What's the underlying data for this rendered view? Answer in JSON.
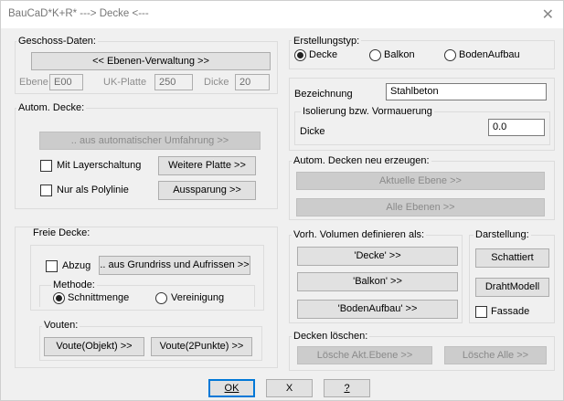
{
  "window": {
    "title": "BauCaD*K+R* ---> Decke <---",
    "close_glyph": "✕"
  },
  "geschoss": {
    "label": "Geschoss-Daten:",
    "ebenen_button": "<< Ebenen-Verwaltung >>",
    "ebene_label": "Ebene",
    "ebene_value": "E00",
    "uk_label": "UK-Platte",
    "uk_value": "250",
    "dicke_label": "Dicke",
    "dicke_value": "20"
  },
  "autom": {
    "label": "Autom. Decke:",
    "umfahrung_button": ".. aus automatischer Umfahrung >>",
    "layerschaltung_label": "Mit Layerschaltung",
    "weitere_button": "Weitere Platte >>",
    "polylinie_label": "Nur als Polylinie",
    "aussparung_button": "Aussparung >>"
  },
  "freie": {
    "label": "Freie Decke:",
    "abzug_label": "Abzug",
    "grundriss_button": ".. aus Grundriss und Aufrissen >>",
    "methode_label": "Methode:",
    "schnittmenge_label": "Schnittmenge",
    "vereinigung_label": "Vereinigung",
    "vouten_label": "Vouten:",
    "voute_objekt_button": "Voute(Objekt) >>",
    "voute_punkte_button": "Voute(2Punkte) >>"
  },
  "erstellungstyp": {
    "label": "Erstellungstyp:",
    "options": [
      "Decke",
      "Balkon",
      "BodenAufbau"
    ],
    "selected": "Decke"
  },
  "bezeichnung": {
    "label": "Bezeichnung",
    "value": "Stahlbeton",
    "isolierung_label": "Isolierung bzw. Vormauerung",
    "dicke_label": "Dicke",
    "dicke_value": "0.0"
  },
  "neu": {
    "label": "Autom. Decken neu erzeugen:",
    "aktuelle_button": "Aktuelle Ebene >>",
    "alle_button": "Alle Ebenen >>"
  },
  "volumen": {
    "label": "Vorh. Volumen definieren als:",
    "decke_button": "'Decke' >>",
    "balkon_button": "'Balkon' >>",
    "boden_button": "'BodenAufbau' >>"
  },
  "darstellung": {
    "label": "Darstellung:",
    "schattiert_button": "Schattiert",
    "draht_button": "DrahtModell",
    "fassade_label": "Fassade"
  },
  "loeschen": {
    "label": "Decken löschen:",
    "akt_button": "Lösche Akt.Ebene >>",
    "alle_button": "Lösche Alle >>"
  },
  "footer": {
    "ok": "OK",
    "x": "X",
    "help": "?"
  }
}
